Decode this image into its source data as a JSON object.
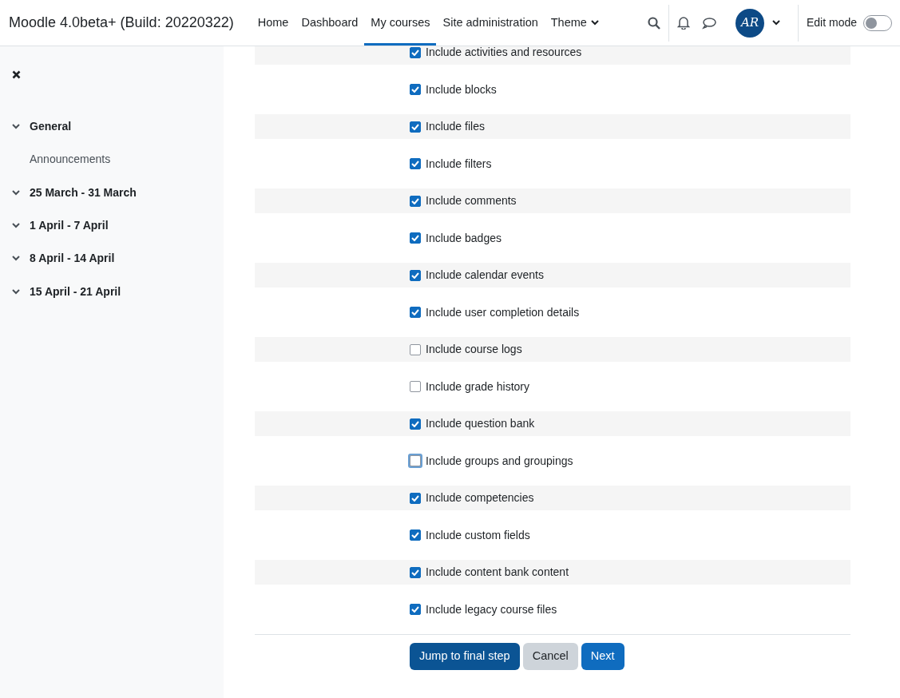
{
  "navbar": {
    "brand": "Moodle 4.0beta+ (Build: 20220322)",
    "links": [
      {
        "label": "Home",
        "selected": false,
        "dropdown": false
      },
      {
        "label": "Dashboard",
        "selected": false,
        "dropdown": false
      },
      {
        "label": "My courses",
        "selected": true,
        "dropdown": false
      },
      {
        "label": "Site administration",
        "selected": false,
        "dropdown": false
      },
      {
        "label": "Theme",
        "selected": false,
        "dropdown": true
      }
    ],
    "avatar": {
      "initials": "AR"
    },
    "edit_mode": {
      "label": "Edit mode",
      "on": false
    }
  },
  "sidebar": {
    "items": [
      {
        "label": "General",
        "kind": "section",
        "expanded": true
      },
      {
        "label": "Announcements",
        "kind": "activity"
      },
      {
        "label": "25 March - 31 March",
        "kind": "section",
        "expanded": true
      },
      {
        "label": "1 April - 7 April",
        "kind": "section",
        "expanded": true
      },
      {
        "label": "8 April - 14 April",
        "kind": "section",
        "expanded": true
      },
      {
        "label": "15 April - 21 April",
        "kind": "section",
        "expanded": true
      }
    ]
  },
  "settings": [
    {
      "label": "Include activities and resources",
      "checked": true,
      "focused": false
    },
    {
      "label": "Include blocks",
      "checked": true,
      "focused": false
    },
    {
      "label": "Include files",
      "checked": true,
      "focused": false
    },
    {
      "label": "Include filters",
      "checked": true,
      "focused": false
    },
    {
      "label": "Include comments",
      "checked": true,
      "focused": false
    },
    {
      "label": "Include badges",
      "checked": true,
      "focused": false
    },
    {
      "label": "Include calendar events",
      "checked": true,
      "focused": false
    },
    {
      "label": "Include user completion details",
      "checked": true,
      "focused": false
    },
    {
      "label": "Include course logs",
      "checked": false,
      "focused": false
    },
    {
      "label": "Include grade history",
      "checked": false,
      "focused": false
    },
    {
      "label": "Include question bank",
      "checked": true,
      "focused": false
    },
    {
      "label": "Include groups and groupings",
      "checked": false,
      "focused": true
    },
    {
      "label": "Include competencies",
      "checked": true,
      "focused": false
    },
    {
      "label": "Include custom fields",
      "checked": true,
      "focused": false
    },
    {
      "label": "Include content bank content",
      "checked": true,
      "focused": false
    },
    {
      "label": "Include legacy course files",
      "checked": true,
      "focused": false
    }
  ],
  "buttons": [
    {
      "label": "Jump to final step",
      "kind": "primary",
      "hovered": true
    },
    {
      "label": "Cancel",
      "kind": "secondary",
      "hovered": false
    },
    {
      "label": "Next",
      "kind": "primary",
      "hovered": false
    }
  ]
}
